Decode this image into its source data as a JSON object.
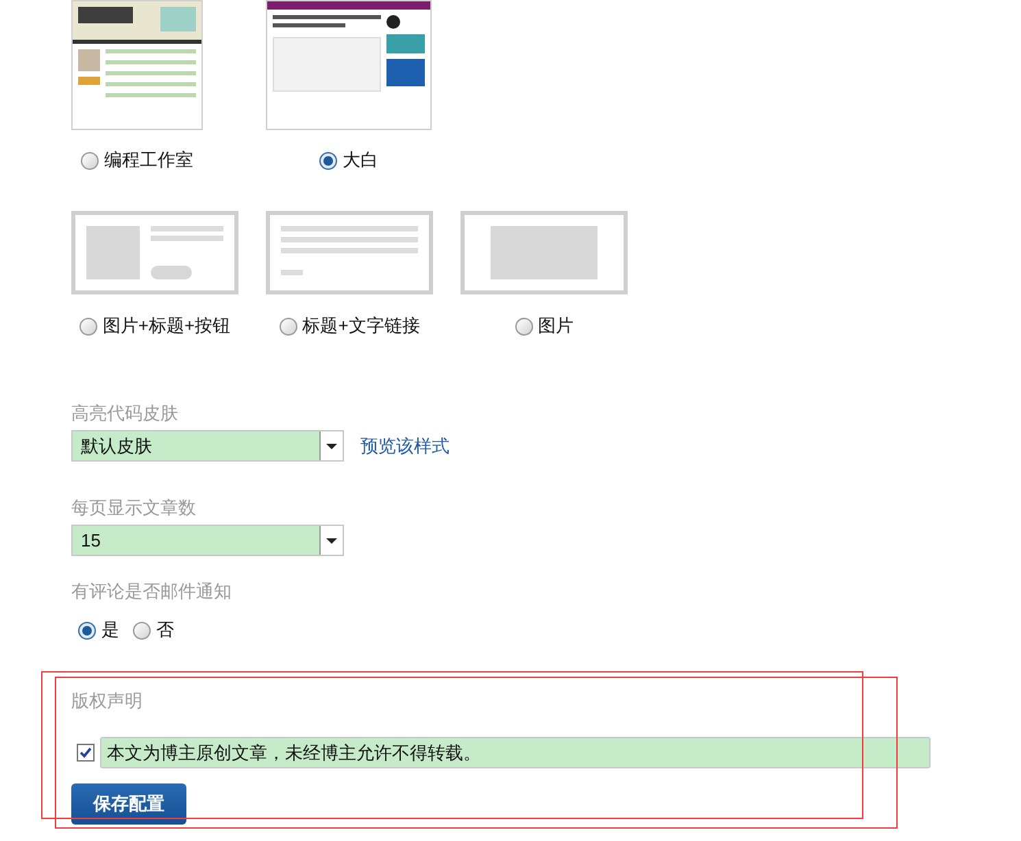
{
  "themes": [
    {
      "kind": "studio",
      "label": "编程工作室",
      "selected": false
    },
    {
      "kind": "white",
      "label": "大白",
      "selected": true
    }
  ],
  "layouts": [
    {
      "kind": "image-title-button",
      "label": "图片+标题+按钮",
      "selected": false
    },
    {
      "kind": "title-text-link",
      "label": "标题+文字链接",
      "selected": false
    },
    {
      "kind": "image",
      "label": "图片",
      "selected": false
    }
  ],
  "code_skin": {
    "label": "高亮代码皮肤",
    "value": "默认皮肤",
    "link": "预览该样式"
  },
  "per_page": {
    "label": "每页显示文章数",
    "value": "15"
  },
  "comment_email": {
    "label": "有评论是否邮件通知",
    "options": [
      {
        "label": "是",
        "selected": true
      },
      {
        "label": "否",
        "selected": false
      }
    ]
  },
  "copyright": {
    "label": "版权声明",
    "checked": true,
    "value": "本文为博主原创文章，未经博主允许不得转载。"
  },
  "save_button": "保存配置"
}
